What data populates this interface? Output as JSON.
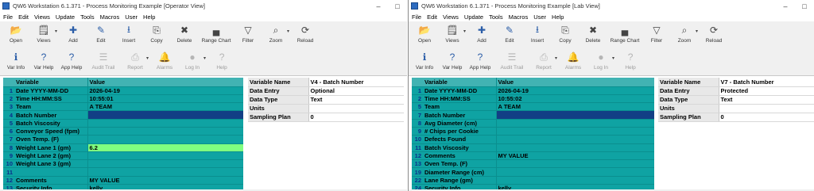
{
  "colors": {
    "grid_bg": "#0fa3a3",
    "header_bg": "#41b3b3",
    "selected_cell": "#123f85",
    "edit_cell": "#80ff80",
    "row_number": "#0b2f8a"
  },
  "menu": [
    "File",
    "Edit",
    "Views",
    "Update",
    "Tools",
    "Macros",
    "User",
    "Help"
  ],
  "toolbar1": [
    {
      "label": "Open",
      "icon": "folder-icon",
      "enabled": true
    },
    {
      "label": "Views",
      "icon": "views-icon",
      "enabled": true,
      "dropdown": true
    },
    {
      "label": "Add",
      "icon": "add-row-icon",
      "enabled": true
    },
    {
      "label": "Edit",
      "icon": "edit-row-icon",
      "enabled": true
    },
    {
      "label": "Insert",
      "icon": "insert-row-icon",
      "enabled": true
    },
    {
      "label": "Copy",
      "icon": "copy-icon",
      "enabled": true
    },
    {
      "label": "Delete",
      "icon": "delete-row-icon",
      "enabled": true
    },
    {
      "label": "Range Chart",
      "icon": "range-chart-icon",
      "enabled": true
    },
    {
      "label": "Filter",
      "icon": "filter-icon",
      "enabled": true
    },
    {
      "label": "Zoom",
      "icon": "zoom-icon",
      "enabled": true,
      "dropdown": true
    },
    {
      "label": "Reload",
      "icon": "reload-icon",
      "enabled": true
    }
  ],
  "toolbar2": [
    {
      "label": "Var Info",
      "icon": "var-info-icon",
      "enabled": true
    },
    {
      "label": "Var Help",
      "icon": "var-help-icon",
      "enabled": true
    },
    {
      "label": "App Help",
      "icon": "app-help-icon",
      "enabled": true
    },
    {
      "label": "Audit Trail",
      "icon": "audit-trail-icon",
      "enabled": false
    },
    {
      "label": "Report",
      "icon": "report-icon",
      "enabled": false,
      "dropdown": true
    },
    {
      "label": "Alarms",
      "icon": "alarm-bell-icon",
      "enabled": false
    },
    {
      "label": "Log In",
      "icon": "user-icon",
      "enabled": false,
      "dropdown": true
    },
    {
      "label": "Help",
      "icon": "help-icon",
      "enabled": false
    }
  ],
  "left": {
    "title": "QW6 Workstation 6.1.371 - Process Monitoring Example [Operator View]",
    "grid_headers": {
      "variable": "Variable",
      "value": "Value"
    },
    "rows": [
      {
        "num": "1",
        "variable": "Date  YYYY-MM-DD",
        "value": "2026-04-19"
      },
      {
        "num": "2",
        "variable": "Time  HH:MM:SS",
        "value": "10:55:01"
      },
      {
        "num": "3",
        "variable": "Team",
        "value": "A TEAM"
      },
      {
        "num": "4",
        "variable": "Batch Number",
        "value": "",
        "state": "selected"
      },
      {
        "num": "5",
        "variable": "Batch Viscosity",
        "value": ""
      },
      {
        "num": "6",
        "variable": "Conveyor Speed (fpm)",
        "value": ""
      },
      {
        "num": "7",
        "variable": "Oven Temp. (F)",
        "value": ""
      },
      {
        "num": "8",
        "variable": "Weight Lane 1 (gm)",
        "value": "6.2",
        "state": "edit"
      },
      {
        "num": "9",
        "variable": "Weight Lane 2 (gm)",
        "value": ""
      },
      {
        "num": "10",
        "variable": "Weight Lane 3 (gm)",
        "value": ""
      },
      {
        "num": "11",
        "variable": "",
        "value": ""
      },
      {
        "num": "12",
        "variable": "Comments",
        "value": "MY VALUE"
      },
      {
        "num": "13",
        "variable": "Security Info",
        "value": "kelly"
      }
    ],
    "props": [
      {
        "k": "Variable Name",
        "v": "V4 - Batch Number"
      },
      {
        "k": "Data Entry",
        "v": "Optional"
      },
      {
        "k": "Data Type",
        "v": "Text"
      },
      {
        "k": "Units",
        "v": ""
      },
      {
        "k": "Sampling Plan",
        "v": "0"
      }
    ]
  },
  "right": {
    "title": "QW6 Workstation 6.1.371 - Process Monitoring Example [Lab View]",
    "grid_headers": {
      "variable": "Variable",
      "value": "Value"
    },
    "rows": [
      {
        "num": "1",
        "variable": "Date  YYYY-MM-DD",
        "value": "2026-04-19"
      },
      {
        "num": "2",
        "variable": "Time  HH:MM:SS",
        "value": "10:55:02"
      },
      {
        "num": "5",
        "variable": "Team",
        "value": "A TEAM"
      },
      {
        "num": "7",
        "variable": "Batch Number",
        "value": "",
        "state": "selected"
      },
      {
        "num": "8",
        "variable": "Avg Diameter (cm)",
        "value": ""
      },
      {
        "num": "9",
        "variable": "# Chips per Cookie",
        "value": ""
      },
      {
        "num": "10",
        "variable": "Defects Found",
        "value": ""
      },
      {
        "num": "11",
        "variable": "Batch Viscosity",
        "value": ""
      },
      {
        "num": "12",
        "variable": "Comments",
        "value": "MY VALUE"
      },
      {
        "num": "13",
        "variable": "Oven Temp. (F)",
        "value": ""
      },
      {
        "num": "19",
        "variable": "Diameter Range (cm)",
        "value": ""
      },
      {
        "num": "22",
        "variable": "Lane Range (gm)",
        "value": ""
      },
      {
        "num": "24",
        "variable": "Security Info",
        "value": "kelly"
      }
    ],
    "props": [
      {
        "k": "Variable Name",
        "v": "V7 - Batch Number"
      },
      {
        "k": "Data Entry",
        "v": "Protected"
      },
      {
        "k": "Data Type",
        "v": "Text"
      },
      {
        "k": "Units",
        "v": ""
      },
      {
        "k": "Sampling Plan",
        "v": "0"
      }
    ]
  }
}
